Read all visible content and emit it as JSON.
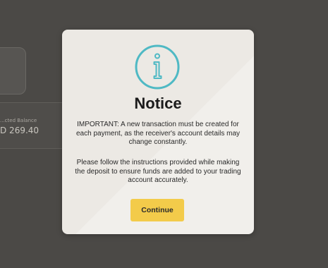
{
  "background": {
    "balance_label": "...cted Balance",
    "balance_value": "D 269.40"
  },
  "modal": {
    "icon": "info-icon",
    "accent_color": "#4fb9c4",
    "title": "Notice",
    "paragraph1": "IMPORTANT: A new transaction must be created for each payment, as the receiver's account details may change constantly.",
    "paragraph2": "Please follow the instructions provided while making the deposit to ensure funds are added to your trading account accurately.",
    "continue_label": "Continue",
    "button_color": "#f3cb4a"
  }
}
